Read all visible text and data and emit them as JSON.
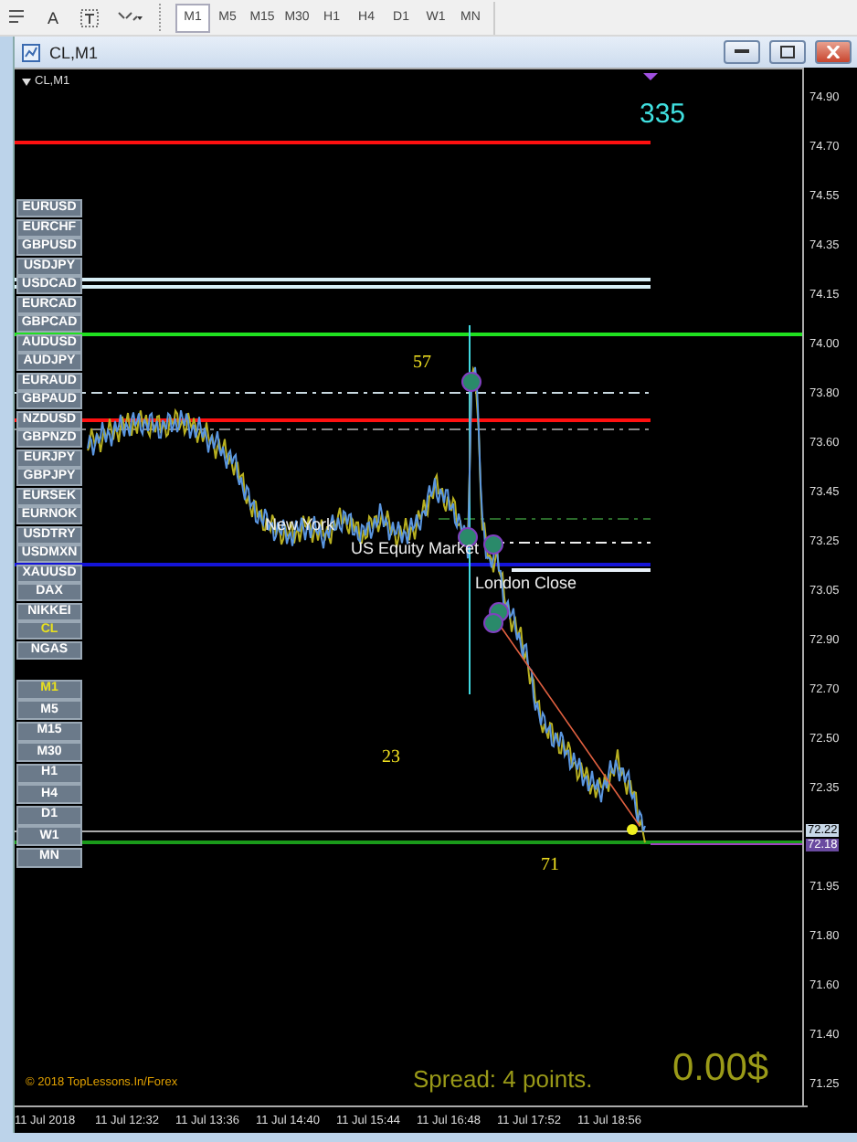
{
  "toolbar": {
    "text_tool": "A",
    "periods": [
      {
        "label": "M1",
        "selected": true
      },
      {
        "label": "M5",
        "selected": false
      },
      {
        "label": "M15",
        "selected": false
      },
      {
        "label": "M30",
        "selected": false
      },
      {
        "label": "H1",
        "selected": false
      },
      {
        "label": "H4",
        "selected": false
      },
      {
        "label": "D1",
        "selected": false
      },
      {
        "label": "W1",
        "selected": false
      },
      {
        "label": "MN",
        "selected": false
      }
    ]
  },
  "window": {
    "title": "CL,M1"
  },
  "chart": {
    "header": "CL,M1",
    "symbols": [
      {
        "label": "EURUSD",
        "selected": false
      },
      {
        "label": "EURCHF",
        "selected": false
      },
      {
        "label": "GBPUSD",
        "selected": false
      },
      {
        "label": "USDJPY",
        "selected": false
      },
      {
        "label": "USDCAD",
        "selected": false
      },
      {
        "label": "EURCAD",
        "selected": false
      },
      {
        "label": "GBPCAD",
        "selected": false
      },
      {
        "label": "AUDUSD",
        "selected": false
      },
      {
        "label": "AUDJPY",
        "selected": false
      },
      {
        "label": "EURAUD",
        "selected": false
      },
      {
        "label": "GBPAUD",
        "selected": false
      },
      {
        "label": "NZDUSD",
        "selected": false
      },
      {
        "label": "GBPNZD",
        "selected": false
      },
      {
        "label": "EURJPY",
        "selected": false
      },
      {
        "label": "GBPJPY",
        "selected": false
      },
      {
        "label": "EURSEK",
        "selected": false
      },
      {
        "label": "EURNOK",
        "selected": false
      },
      {
        "label": "USDTRY",
        "selected": false
      },
      {
        "label": "USDMXN",
        "selected": false
      },
      {
        "label": "XAUUSD",
        "selected": false
      },
      {
        "label": "DAX",
        "selected": false
      },
      {
        "label": "NIKKEI",
        "selected": false
      },
      {
        "label": "CL",
        "selected": true
      },
      {
        "label": "NGAS",
        "selected": false
      }
    ],
    "timeframes": [
      {
        "label": "M1",
        "selected": true
      },
      {
        "label": "M5",
        "selected": false
      },
      {
        "label": "M15",
        "selected": false
      },
      {
        "label": "M30",
        "selected": false
      },
      {
        "label": "H1",
        "selected": false
      },
      {
        "label": "H4",
        "selected": false
      },
      {
        "label": "D1",
        "selected": false
      },
      {
        "label": "W1",
        "selected": false
      },
      {
        "label": "MN",
        "selected": false
      }
    ],
    "labels": [
      {
        "kind": "tick_count",
        "text": "335"
      },
      {
        "kind": "count",
        "text": "57"
      },
      {
        "kind": "session",
        "text": "New York"
      },
      {
        "kind": "session",
        "text": "US Equity Market"
      },
      {
        "kind": "session",
        "text": "London Close"
      },
      {
        "kind": "count",
        "text": "23"
      },
      {
        "kind": "count",
        "text": "71"
      }
    ],
    "copyright": "© 2018 TopLessons.In/Forex",
    "spread": "Spread: 4 points.",
    "profit": "0.00$"
  },
  "price_axis": {
    "labels": [
      "74.90",
      "74.70",
      "74.55",
      "74.35",
      "74.15",
      "74.00",
      "73.80",
      "73.60",
      "73.45",
      "73.25",
      "73.05",
      "72.90",
      "72.70",
      "72.50",
      "72.35",
      "71.95",
      "71.80",
      "71.60",
      "71.40",
      "71.25"
    ],
    "current_prices": [
      "72.22",
      "72.18"
    ]
  },
  "time_axis": {
    "labels": [
      "11 Jul 2018",
      "11 Jul 12:32",
      "11 Jul 13:36",
      "11 Jul 14:40",
      "11 Jul 15:44",
      "11 Jul 16:48",
      "11 Jul 17:52",
      "11 Jul 18:56"
    ]
  }
}
